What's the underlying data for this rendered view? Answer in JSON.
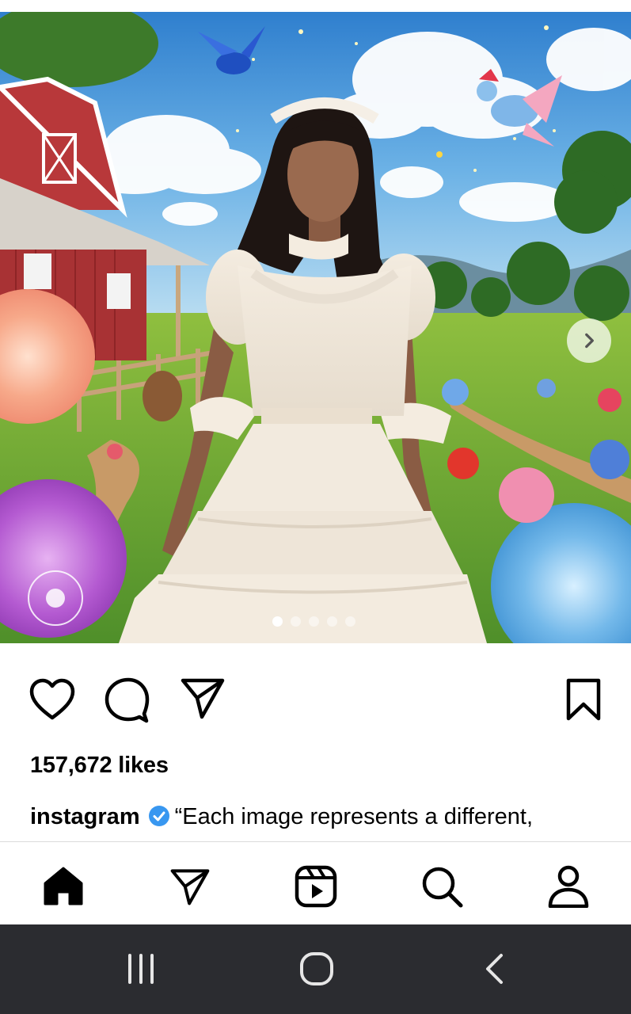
{
  "post": {
    "image_alt": "Woman in white ruffled dress on a farm",
    "carousel": {
      "dot_count": 5,
      "active_index": 0
    }
  },
  "actions": {
    "like_icon": "heart-icon",
    "comment_icon": "comment-icon",
    "share_icon": "send-icon",
    "save_icon": "bookmark-icon"
  },
  "likes_text": "157,672 likes",
  "caption": {
    "username": "instagram",
    "text": "“Each image represents a different,"
  },
  "bottom_nav": {
    "items": [
      "home-icon",
      "messages-icon",
      "reels-icon",
      "search-icon",
      "profile-icon"
    ]
  },
  "system_nav": {
    "items": [
      "recents-icon",
      "home-circle-icon",
      "back-icon"
    ]
  },
  "colors": {
    "verified_badge": "#3897f0",
    "system_bar": "#2b2c30",
    "sky": "#4a94d6",
    "barn": "#b8383a"
  }
}
